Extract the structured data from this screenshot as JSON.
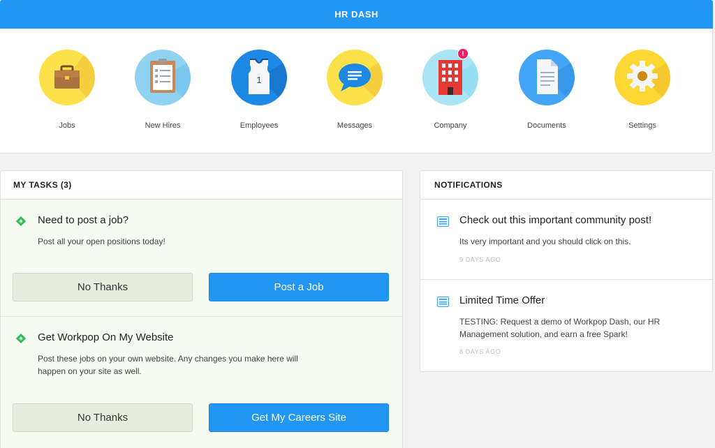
{
  "header": {
    "title": "HR DASH"
  },
  "nav": {
    "items": [
      {
        "label": "Jobs",
        "icon": "briefcase-icon"
      },
      {
        "label": "New Hires",
        "icon": "clipboard-icon"
      },
      {
        "label": "Employees",
        "icon": "jersey-icon",
        "jersey_number": "1"
      },
      {
        "label": "Messages",
        "icon": "chat-bubble-icon"
      },
      {
        "label": "Company",
        "icon": "building-icon",
        "badge": "!"
      },
      {
        "label": "Documents",
        "icon": "document-icon"
      },
      {
        "label": "Settings",
        "icon": "gear-icon"
      }
    ]
  },
  "tasks": {
    "header": "MY TASKS (3)",
    "items": [
      {
        "title": "Need to post a job?",
        "description": "Post all your open positions today!",
        "dismiss_label": "No Thanks",
        "action_label": "Post a Job"
      },
      {
        "title": "Get Workpop On My Website",
        "description": "Post these jobs on your own website. Any changes you make here will happen on your site as well.",
        "dismiss_label": "No Thanks",
        "action_label": "Get My Careers Site"
      }
    ]
  },
  "notifications": {
    "header": "NOTIFICATIONS",
    "items": [
      {
        "title": "Check out this important community post!",
        "body": "Its very important and you should click on this.",
        "time": "9 DAYS AGO"
      },
      {
        "title": "Limited Time Offer",
        "body": "TESTING: Request a demo of Workpop Dash, our HR Management solution, and earn a free Spark!",
        "time": "8 DAYS AGO"
      }
    ]
  },
  "colors": {
    "primary": "#2196f3",
    "task_background": "#f5fbf1",
    "badge": "#e91e63",
    "task_icon": "#2ebd59"
  }
}
